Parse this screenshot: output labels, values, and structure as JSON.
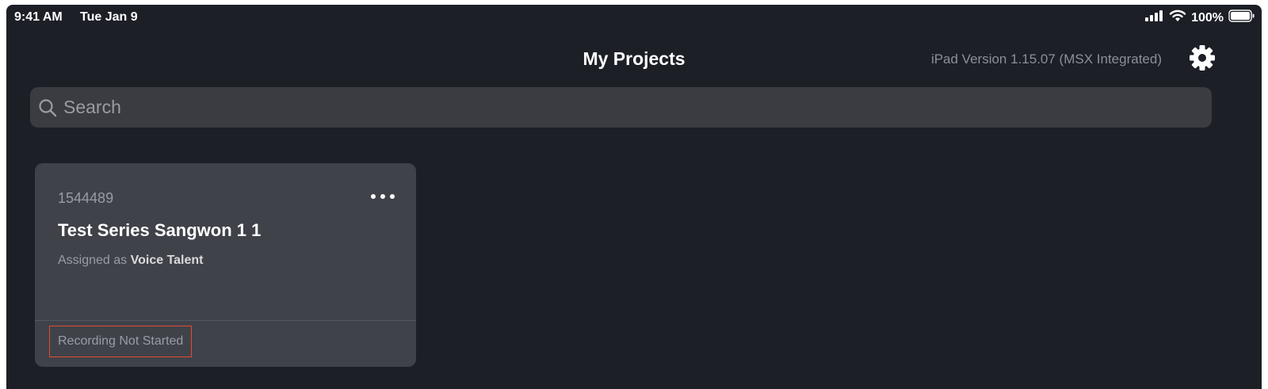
{
  "status_bar": {
    "time": "9:41 AM",
    "date": "Tue Jan 9",
    "battery_percent": "100%",
    "icons": [
      "cellular-signal-icon",
      "wifi-icon",
      "battery-icon"
    ]
  },
  "nav": {
    "title": "My Projects",
    "version": "iPad Version 1.15.07 (MSX Integrated)",
    "settings_icon": "gear-icon"
  },
  "search": {
    "placeholder": "Search",
    "value": ""
  },
  "projects": [
    {
      "id": "1544489",
      "title": "Test Series Sangwon 1 1",
      "assigned_prefix": "Assigned as",
      "role": "Voice Talent",
      "status": "Recording Not Started",
      "more_icon": "ellipsis-icon"
    }
  ],
  "colors": {
    "background": "#1d1f27",
    "card": "#40424a",
    "search_field": "#3a3c42",
    "secondary_text": "#9a9ca3",
    "highlight_border": "#e04b2f"
  }
}
